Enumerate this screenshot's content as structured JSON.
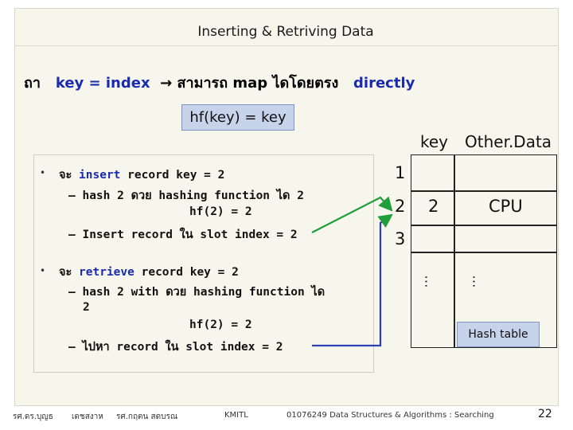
{
  "slide": {
    "title": "Inserting & Retriving Data",
    "intro": {
      "prefix": "ถา",
      "mid": "key = index",
      "arrow": "→",
      "text": "สามารถ map ไดโดยตรง",
      "directly": "directly"
    },
    "hf_box": "hf(key) = key",
    "bullets": [
      {
        "symbol": "•",
        "lead": "จะ",
        "action": "insert",
        "rest": "record key = 2",
        "sub1": "– hash 2 ดวย hashing function ได 2",
        "sub2": "hf(2) = 2",
        "sub3": "– Insert record ใน slot index = 2"
      },
      {
        "symbol": "•",
        "lead": "จะ",
        "action": "retrieve",
        "rest": "record key = 2",
        "sub1": "– hash 2 with ดวย hashing function ได",
        "sub1b": "2",
        "sub2": "hf(2) = 2",
        "sub3": "– ไปหา record ใน slot index = 2"
      }
    ],
    "table": {
      "header_key": "key",
      "header_other": "Other.Data",
      "indices": [
        "1",
        "2",
        "3"
      ],
      "row2_key": "2",
      "row2_data": "CPU",
      "ellipsis": "…",
      "label": "Hash table"
    },
    "footer": {
      "author": "รศ.ดร.บุญธ",
      "author2": "เดชสงาห",
      "author3": "รศ.กฤตน สดบรณ",
      "org": "KMITL",
      "course": "01076249 Data Structures & Algorithms : Searching",
      "page": "22"
    },
    "colors": {
      "accent_blue": "#1a2bb0",
      "arrow_green": "#1f9e3a",
      "box_blue": "#c7d3ea"
    }
  }
}
